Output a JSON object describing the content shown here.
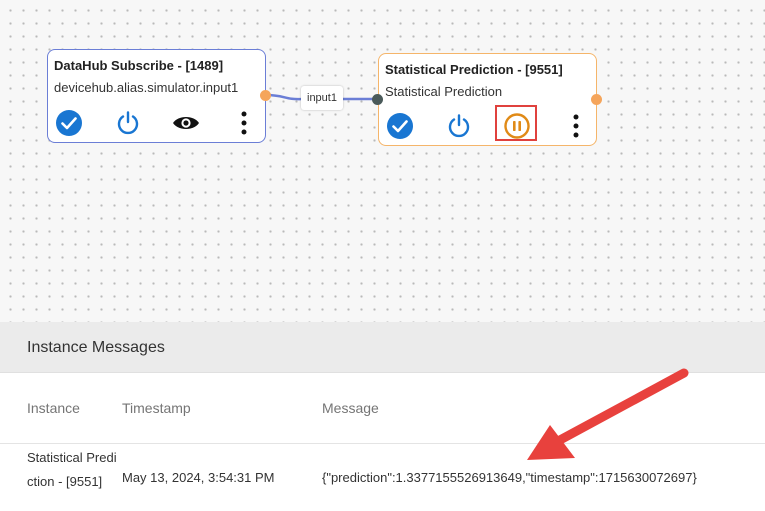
{
  "nodes": [
    {
      "title": "DataHub Subscribe - [1489]",
      "subtitle": "devicehub.alias.simulator.input1",
      "actions": [
        "check-circle-icon",
        "power-icon",
        "eye-icon",
        "more-vertical-icon"
      ]
    },
    {
      "title": "Statistical Prediction - [9551]",
      "subtitle": "Statistical Prediction",
      "actions": [
        "check-circle-icon",
        "power-icon",
        "pause-circle-icon",
        "more-vertical-icon"
      ]
    }
  ],
  "edge": {
    "label": "input1"
  },
  "colors": {
    "accent_blue": "#1976d2",
    "pause_orange": "#e08a17",
    "port_orange": "#f5a55b",
    "port_dark": "#4a5a5a",
    "edge_line": "#6b7ed6",
    "highlight_red": "#e0413d",
    "arrow_red": "#e8413d"
  },
  "panel": {
    "title": "Instance Messages",
    "columns": [
      "Instance",
      "Timestamp",
      "Message"
    ],
    "rows": [
      {
        "instance": "Statistical Prediction - [9551]",
        "timestamp": "May 13, 2024, 3:54:31 PM",
        "message": "{\"prediction\":1.3377155526913649,\"timestamp\":1715630072697}"
      }
    ]
  }
}
